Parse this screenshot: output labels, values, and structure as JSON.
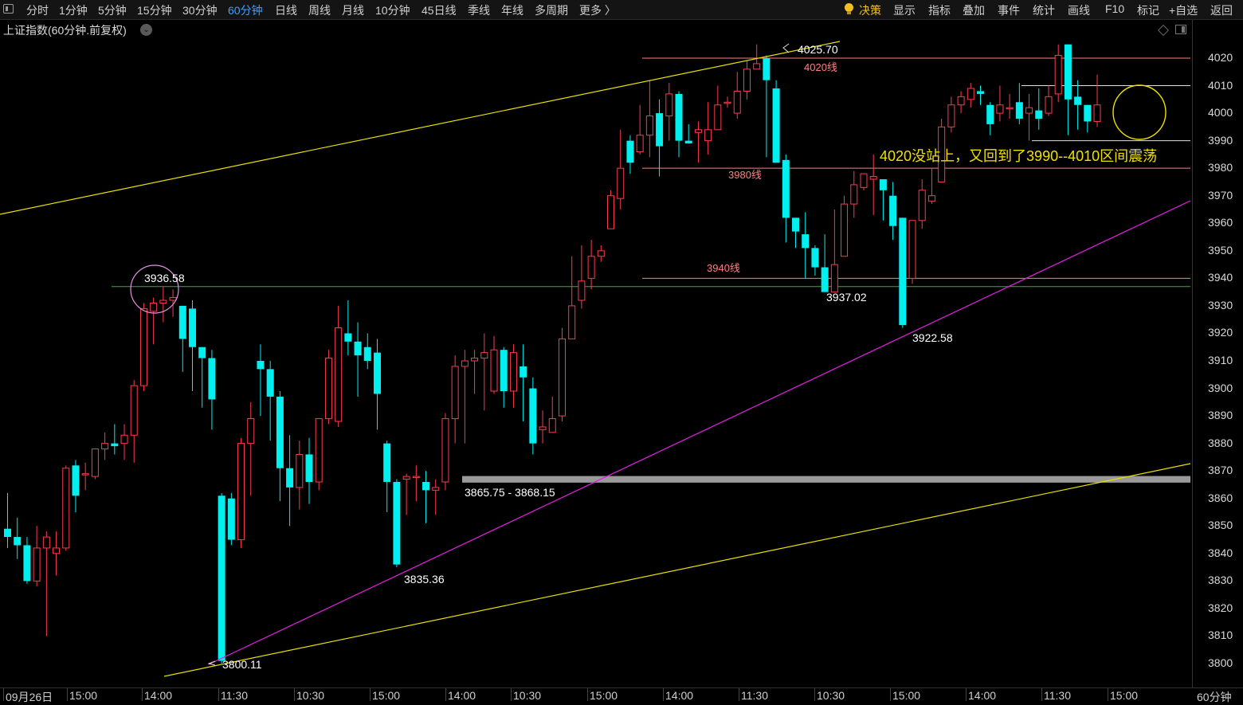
{
  "toolbar": {
    "periods": [
      "分时",
      "1分钟",
      "5分钟",
      "15分钟",
      "30分钟",
      "60分钟",
      "日线",
      "周线",
      "月线",
      "10分钟",
      "45日线",
      "季线",
      "年线",
      "多周期",
      "更多 〉"
    ],
    "active_period": "60分钟",
    "right_items": [
      "决策",
      "显示",
      "指标",
      "叠加",
      "事件",
      "统计",
      "画线",
      "F10",
      "标记",
      "+自选",
      "返回"
    ]
  },
  "chart_title": "上证指数(60分钟.前复权)",
  "period_label": "60分钟",
  "colors": {
    "up": "#ff3a4e",
    "down": "#00f0f0",
    "yellow_line": "#e8e000",
    "magenta_line": "#e020e0",
    "green_line": "#20c020",
    "pink_line": "#ff8080",
    "gray_band": "#9a9a9a",
    "annotation": "#f0e000"
  },
  "chart_data": {
    "type": "candlestick",
    "interval": "60分钟",
    "ylim": [
      3796,
      4032
    ],
    "yticks": [
      3800,
      3810,
      3820,
      3830,
      3840,
      3850,
      3860,
      3870,
      3880,
      3890,
      3900,
      3910,
      3920,
      3930,
      3940,
      3950,
      3960,
      3970,
      3980,
      3990,
      4000,
      4010,
      4020
    ],
    "xlabels": [
      "09月26日",
      "15:00",
      "14:00",
      "11:30",
      "10:30",
      "15:00",
      "14:00",
      "10:30",
      "15:00",
      "14:00",
      "11:30",
      "10:30",
      "15:00",
      "14:00",
      "11:30",
      "15:00"
    ],
    "candles": [
      [
        3849,
        3846,
        3862,
        3842
      ],
      [
        3846,
        3843,
        3853,
        3838
      ],
      [
        3843,
        3830,
        3846,
        3829
      ],
      [
        3830,
        3842,
        3850,
        3828
      ],
      [
        3842,
        3846,
        3848,
        3810
      ],
      [
        3840,
        3842,
        3848,
        3832
      ],
      [
        3842,
        3871,
        3872,
        3841
      ],
      [
        3872,
        3861,
        3874,
        3855
      ],
      [
        3869,
        3869,
        3873,
        3863
      ],
      [
        3868,
        3878,
        3878,
        3867
      ],
      [
        3878,
        3880,
        3884,
        3874
      ],
      [
        3880,
        3879,
        3887,
        3876
      ],
      [
        3880,
        3883,
        3887,
        3874
      ],
      [
        3883,
        3901,
        3903,
        3873
      ],
      [
        3901,
        3929,
        3931,
        3899
      ],
      [
        3928,
        3931,
        3933,
        3916
      ],
      [
        3931,
        3932,
        3937,
        3924
      ],
      [
        3932,
        3933,
        3936,
        3926
      ],
      [
        3930,
        3918,
        3930,
        3906
      ],
      [
        3929,
        3915,
        3932,
        3899
      ],
      [
        3915,
        3911,
        3915,
        3893
      ],
      [
        3911,
        3896,
        3914,
        3885
      ],
      [
        3861,
        3801,
        3862,
        3800
      ],
      [
        3860,
        3845,
        3862,
        3843
      ],
      [
        3845,
        3880,
        3882,
        3842
      ],
      [
        3880,
        3889,
        3895,
        3861
      ],
      [
        3910,
        3907,
        3916,
        3890
      ],
      [
        3907,
        3897,
        3910,
        3881
      ],
      [
        3897,
        3871,
        3899,
        3859
      ],
      [
        3871,
        3864,
        3883,
        3850
      ],
      [
        3864,
        3876,
        3881,
        3856
      ],
      [
        3876,
        3866,
        3882,
        3858
      ],
      [
        3866,
        3889,
        3889,
        3863
      ],
      [
        3889,
        3911,
        3914,
        3887
      ],
      [
        3888,
        3922,
        3930,
        3886
      ],
      [
        3920,
        3917,
        3932,
        3912
      ],
      [
        3917,
        3912,
        3924,
        3897
      ],
      [
        3915,
        3910,
        3920,
        3907
      ],
      [
        3913,
        3898,
        3918,
        3885
      ],
      [
        3880,
        3866,
        3881,
        3855
      ],
      [
        3866,
        3836,
        3867,
        3835
      ],
      [
        3867,
        3868,
        3869,
        3854
      ],
      [
        3868,
        3868,
        3872,
        3859
      ],
      [
        3866,
        3863,
        3870,
        3851
      ],
      [
        3863,
        3864,
        3867,
        3854
      ],
      [
        3866,
        3889,
        3891,
        3863
      ],
      [
        3889,
        3908,
        3912,
        3880
      ],
      [
        3908,
        3910,
        3914,
        3880
      ],
      [
        3910,
        3911,
        3914,
        3898
      ],
      [
        3911,
        3913,
        3920,
        3892
      ],
      [
        3899,
        3914,
        3919,
        3898
      ],
      [
        3914,
        3899,
        3915,
        3893
      ],
      [
        3899,
        3913,
        3916,
        3893
      ],
      [
        3908,
        3904,
        3916,
        3888
      ],
      [
        3900,
        3880,
        3904,
        3876
      ],
      [
        3885,
        3886,
        3892,
        3880
      ],
      [
        3884,
        3889,
        3897,
        3885
      ],
      [
        3890,
        3918,
        3922,
        3888
      ],
      [
        3918,
        3930,
        3948,
        3920
      ],
      [
        3932,
        3939,
        3952,
        3929
      ],
      [
        3940,
        3948,
        3954,
        3936
      ],
      [
        3948,
        3950,
        3952,
        3946
      ],
      [
        3958,
        3970,
        3972,
        3966
      ],
      [
        3969,
        3980,
        3994,
        3965
      ],
      [
        3990,
        3982,
        3992,
        3978
      ],
      [
        3986,
        3992,
        4003,
        3985
      ],
      [
        3992,
        3999,
        4012,
        3984
      ],
      [
        4000,
        3988,
        4005,
        3977
      ],
      [
        3999,
        4007,
        4011,
        3990
      ],
      [
        4007,
        3990,
        4008,
        3984
      ],
      [
        3990,
        3989,
        3996,
        3989
      ],
      [
        3993,
        3994,
        3997,
        3982
      ],
      [
        3990,
        3994,
        4004,
        3985
      ],
      [
        3994,
        4003,
        4010,
        3996
      ],
      [
        4004,
        4004,
        4006,
        4002
      ],
      [
        4000,
        4008,
        4015,
        3998
      ],
      [
        4008,
        4016,
        4019,
        4005
      ],
      [
        4016,
        4018,
        4025,
        4016
      ],
      [
        4020,
        4012,
        4021,
        3984
      ],
      [
        4009,
        3982,
        4012,
        3982
      ],
      [
        3983,
        3962,
        3985,
        3953
      ],
      [
        3962,
        3957,
        3962,
        3951
      ],
      [
        3956,
        3951,
        3964,
        3940
      ],
      [
        3951,
        3944,
        3952,
        3941
      ],
      [
        3944,
        3935,
        3956,
        3936
      ],
      [
        3935,
        3945,
        3965,
        3937
      ],
      [
        3948,
        3967,
        3970,
        3952
      ],
      [
        3967,
        3974,
        3979,
        3962
      ],
      [
        3973,
        3978,
        3978,
        3972
      ],
      [
        3976,
        3977,
        3985,
        3963
      ],
      [
        3976,
        3972,
        3975,
        3961
      ],
      [
        3970,
        3959,
        3975,
        3954
      ],
      [
        3962,
        3923,
        3962,
        3922
      ],
      [
        3940,
        3961,
        3961,
        3938
      ],
      [
        3961,
        3972,
        3976,
        3958
      ],
      [
        3968,
        3970,
        3980,
        3967
      ],
      [
        3975,
        3995,
        3998,
        3980
      ],
      [
        3995,
        4003,
        4006,
        3993
      ],
      [
        4003,
        4006,
        4008,
        4000
      ],
      [
        4005,
        4009,
        4011,
        4002
      ],
      [
        4008,
        4007,
        4010,
        4003
      ],
      [
        4003,
        3996,
        4004,
        3992
      ],
      [
        4000,
        4003,
        4010,
        3997
      ],
      [
        4002,
        4002,
        4007,
        3998
      ],
      [
        4004,
        3998,
        4011,
        3996
      ],
      [
        4000,
        4002,
        4007,
        3990
      ],
      [
        4001,
        3998,
        4009,
        3994
      ],
      [
        4000,
        4006,
        4010,
        3999
      ],
      [
        4007,
        4021,
        4025,
        4004
      ],
      [
        4025,
        4005,
        4025,
        3992
      ],
      [
        4006,
        4003,
        4012,
        3994
      ],
      [
        4003,
        3997,
        4003,
        3993
      ],
      [
        3997,
        4003,
        4014,
        3995
      ]
    ],
    "annotations": [
      "3936.58",
      "3800.11",
      "3835.36",
      "3865.75 - 3868.15",
      "4025.70",
      "4020线",
      "3980线",
      "3940线",
      "3937.02",
      "3922.58",
      "4020没站上，又回到了3990--4010区间震荡"
    ]
  }
}
